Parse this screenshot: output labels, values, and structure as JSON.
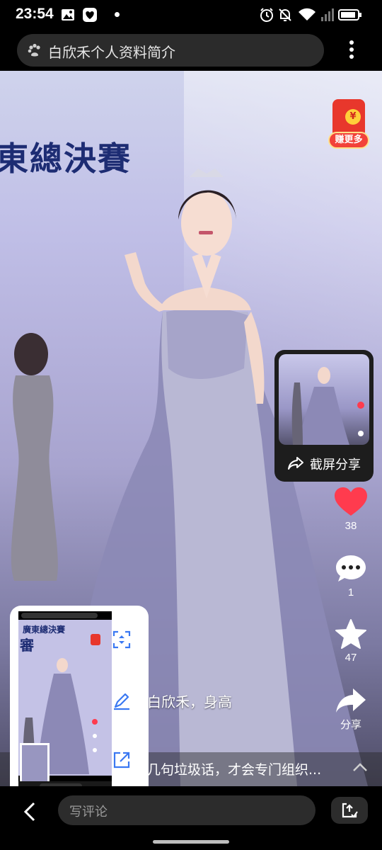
{
  "status_bar": {
    "time": "23:54",
    "icons": [
      "image-icon",
      "heart-app-icon",
      "alarm-icon",
      "mute-bell-icon",
      "wifi-icon",
      "signal-icon",
      "battery-icon"
    ]
  },
  "search": {
    "query": "白欣禾个人资料简介",
    "icon": "paw-icon"
  },
  "video": {
    "backdrop_text": "東總決賽"
  },
  "red_envelope": {
    "coin_symbol": "¥",
    "label": "赚更多"
  },
  "screenshot_card": {
    "share_label": "截屏分享"
  },
  "actions": {
    "like_count": "38",
    "comment_count": "1",
    "favorite_count": "47",
    "share_label": "分享"
  },
  "caption": {
    "line1": "白欣禾，身高",
    "line2": "几句垃圾话，才会专门组织..."
  },
  "float_panel": {
    "thumb_text_1": "廣東總決賽",
    "thumb_text_2": "審",
    "tools": [
      "scan-icon",
      "edit-icon",
      "open-external-icon"
    ]
  },
  "bottom_bar": {
    "comment_placeholder": "写评论"
  },
  "colors": {
    "like_red": "#ff3b4e",
    "envelope_red": "#e8372c",
    "tool_blue": "#3a78f2"
  }
}
